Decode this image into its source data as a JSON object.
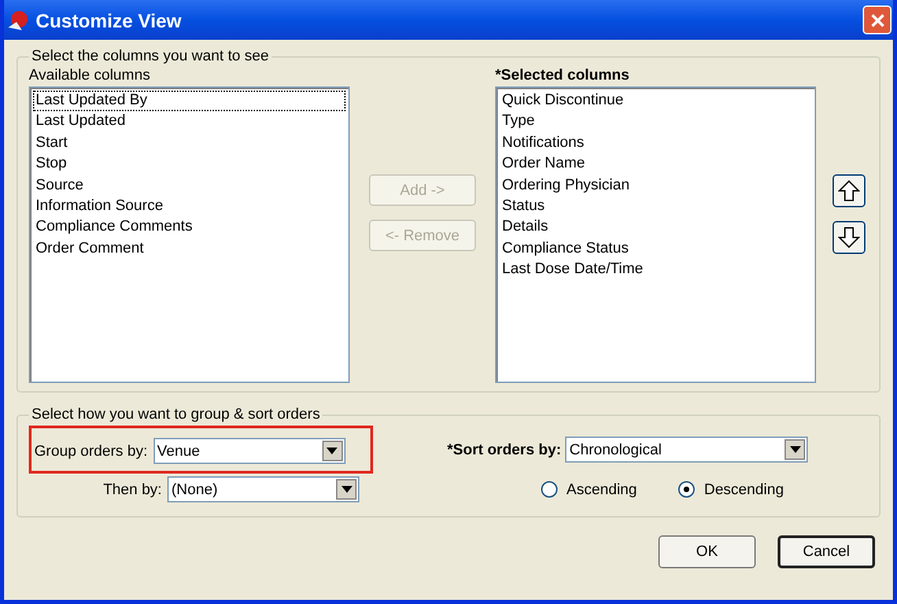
{
  "window": {
    "title": "Customize View"
  },
  "columns_group": {
    "legend": "Select the columns you want to see",
    "available": {
      "label": "Available columns",
      "items": [
        {
          "text": "Last Updated By",
          "focused": true
        },
        {
          "text": "Last Updated",
          "focused": false
        },
        {
          "text": "Start",
          "focused": false
        },
        {
          "text": "Stop",
          "focused": false
        },
        {
          "text": "Source",
          "focused": false
        },
        {
          "text": "Information Source",
          "focused": false
        },
        {
          "text": "Compliance Comments",
          "focused": false
        },
        {
          "text": "Order Comment",
          "focused": false
        }
      ]
    },
    "transfer_buttons": [
      {
        "label": "Add ->",
        "disabled": true
      },
      {
        "label": "<- Remove",
        "disabled": true
      }
    ],
    "selected": {
      "label": "*Selected columns",
      "items": [
        "Quick Discontinue",
        "Type",
        "Notifications",
        "Order Name",
        "Ordering Physician",
        "Status",
        "Details",
        "Compliance Status",
        "Last Dose Date/Time"
      ]
    },
    "move_buttons": [
      {
        "kind": "up"
      },
      {
        "kind": "down"
      }
    ]
  },
  "sort_group": {
    "legend": "Select how you want to group & sort orders",
    "group_by": {
      "label": "Group orders by:",
      "value": "Venue",
      "highlighted": true
    },
    "then_by": {
      "label": "Then by:",
      "value": "(None)"
    },
    "sort_by": {
      "label": "*Sort orders by:",
      "value": "Chronological"
    },
    "order": [
      {
        "label": "Ascending",
        "selected": false
      },
      {
        "label": "Descending",
        "selected": true
      }
    ]
  },
  "buttons": [
    {
      "label": "OK",
      "default": false
    },
    {
      "label": "Cancel",
      "default": true
    }
  ]
}
